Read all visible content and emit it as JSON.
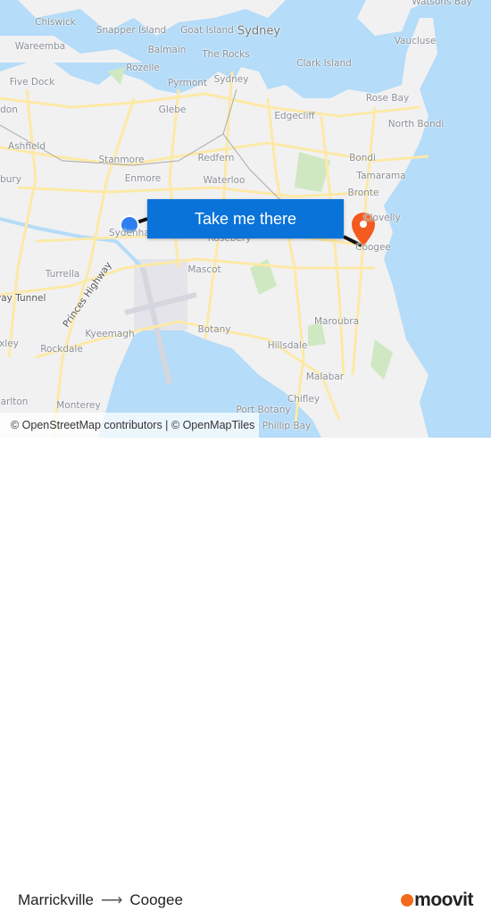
{
  "map": {
    "labels": {
      "chiswick": "Chiswick",
      "snapper_island": "Snapper Island",
      "goat_island": "Goat Island",
      "sydney_city": "Sydney",
      "wareemba": "Wareemba",
      "balmain": "Balmain",
      "the_rocks": "The Rocks",
      "clark_island": "Clark Island",
      "vaucluse": "Vaucluse",
      "rozelle": "Rozelle",
      "five_dock": "Five Dock",
      "pyrmont": "Pyrmont",
      "sydney": "Sydney",
      "rose_bay": "Rose Bay",
      "don": "don",
      "glebe": "Glebe",
      "edgecliff": "Edgecliff",
      "north_bondi": "North Bondi",
      "ashfield": "Ashfield",
      "stanmore": "Stanmore",
      "redfern": "Redfern",
      "bondi": "Bondi",
      "tamarama": "Tamarama",
      "bury": "bury",
      "enmore": "Enmore",
      "waterloo": "Waterloo",
      "bronte": "Bronte",
      "clovelly": "Clovelly",
      "sydenham": "Sydenham",
      "rosebery": "Rosebery",
      "coogee": "Coogee",
      "mascot": "Mascot",
      "turrella": "Turrella",
      "princes_highway": "Princes Highway",
      "way_tunnel": "way Tunnel",
      "maroubra": "Maroubra",
      "botany": "Botany",
      "kyeemagh": "Kyeemagh",
      "hillsdale": "Hillsdale",
      "xley": "xley",
      "rockdale": "Rockdale",
      "malabar": "Malabar",
      "chifley": "Chifley",
      "arlton": "arlton",
      "monterey": "Monterey",
      "port_botany": "Port Botany",
      "phillip_bay": "Phillip Bay",
      "watsons_bay": "Watsons Bay"
    },
    "colors": {
      "land": "#f1f1f2",
      "water": "#b5dcf8",
      "road": "#fde9a6",
      "park": "#cfe8c2",
      "origin": "#2f7ff0",
      "destination": "#f25a1f"
    },
    "take_me_there": "Take me there",
    "attribution": "© OpenStreetMap contributors | © OpenMapTiles"
  },
  "footer": {
    "origin": "Marrickville",
    "arrow": "⟶",
    "destination": "Coogee",
    "brand": "moovit"
  }
}
